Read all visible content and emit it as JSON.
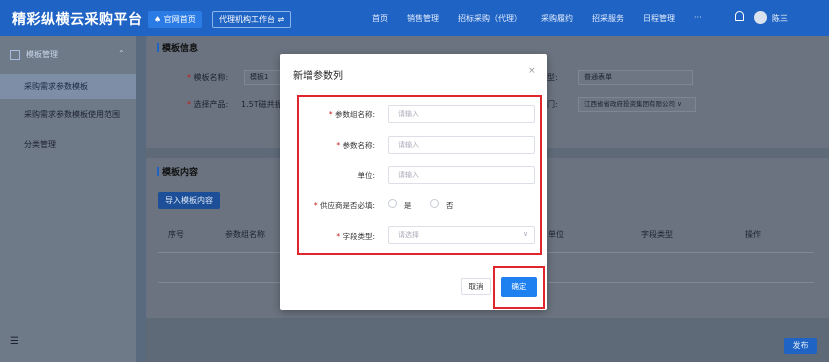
{
  "header": {
    "brand": "精彩纵横云采购平台",
    "home": "♠ 官网首页",
    "agent": "代理机构工作台 ⇌",
    "nav": [
      "首页",
      "销售管理",
      "招标采购（代理）",
      "采购履约",
      "招采服务",
      "日程管理",
      "···"
    ],
    "user": "陈三"
  },
  "sidebar": {
    "head": "模板管理",
    "items": [
      "采购需求参数模板",
      "采购需求参数模板使用范围",
      "分类管理"
    ],
    "active_index": 0,
    "foot_icon": "☰"
  },
  "template_info": {
    "title": "模板信息",
    "name_label": "模板名称:",
    "name_value": "模板1",
    "product_label": "选择产品:",
    "product_value": "1.5T磁共振",
    "type_label": "型:",
    "type_value": "普通表单",
    "dept_label": "门:",
    "dept_value": "江西省省政府投资集团有限公司 ∨"
  },
  "template_content": {
    "title": "模板内容",
    "import_button": "导入模板内容",
    "columns": [
      "序号",
      "参数组名称",
      "单位",
      "字段类型",
      "操作"
    ]
  },
  "publish_button": "发布",
  "modal": {
    "title": "新增参数列",
    "close": "×",
    "fields": [
      {
        "label": "参数组名称:",
        "required": true,
        "placeholder": "请输入"
      },
      {
        "label": "参数名称:",
        "required": true,
        "placeholder": "请输入"
      },
      {
        "label": "单位:",
        "required": false,
        "placeholder": "请输入"
      }
    ],
    "supplier_required_label": "供应商是否必填:",
    "radio_yes": "是",
    "radio_no": "否",
    "field_type_label": "字段类型:",
    "field_type_placeholder": "请选择",
    "cancel": "取消",
    "confirm": "确定"
  },
  "colors": {
    "brand_blue": "#1f63c4",
    "primary_button": "#1f80f0",
    "highlight_red": "#e0262c",
    "required_red": "#e0262c"
  }
}
